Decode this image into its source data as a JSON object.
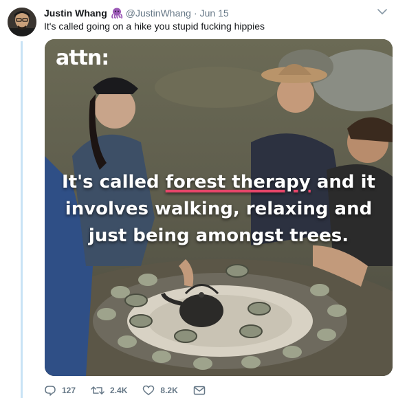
{
  "tweet": {
    "display_name": "Justin Whang",
    "handle": "@JustinWhang",
    "separator": "·",
    "date": "Jun 15",
    "text": "It's called going on a hike you stupid fucking hippies"
  },
  "media": {
    "logo": "attn:",
    "caption": {
      "line1_pre": "It's called ",
      "line1_highlight": "forest therapy",
      "line1_post": " and it",
      "line2": "involves walking, relaxing and",
      "line3": "just being amongst trees."
    }
  },
  "actions": {
    "replies": "127",
    "retweets": "2.4K",
    "likes": "8.2K"
  },
  "icons": {
    "name_emoji": "octopus-icon",
    "caret": "chevron-down-icon",
    "reply": "reply-icon",
    "retweet": "retweet-icon",
    "like": "heart-icon",
    "dm": "envelope-icon"
  },
  "colors": {
    "thread_line": "#c8e3f5",
    "secondary_text": "#657786",
    "highlight_underline": "#e8466a",
    "octopus": "#9b59b6"
  }
}
